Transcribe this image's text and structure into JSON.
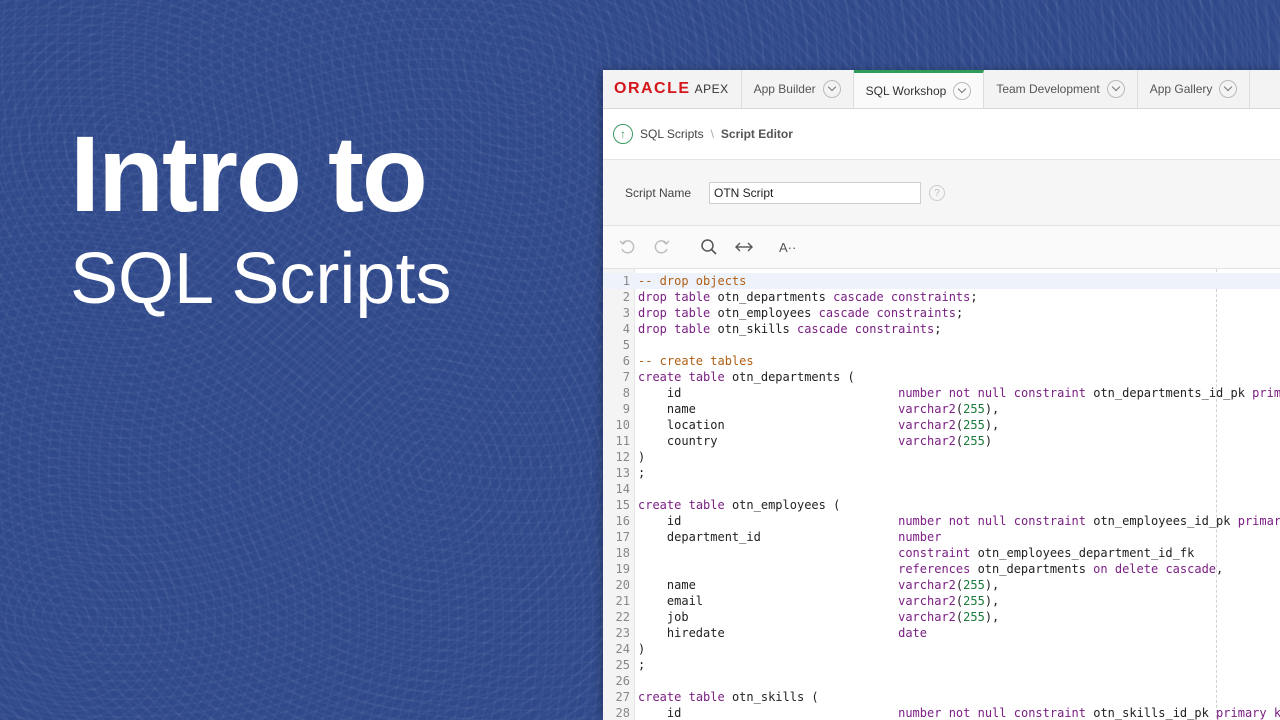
{
  "hero": {
    "line1": "Intro to",
    "line2": "SQL Scripts"
  },
  "nav": {
    "brand_oracle": "ORACLE",
    "brand_apex": "APEX",
    "tabs": [
      {
        "label": "App Builder",
        "active": false
      },
      {
        "label": "SQL Workshop",
        "active": true
      },
      {
        "label": "Team Development",
        "active": false
      },
      {
        "label": "App Gallery",
        "active": false
      }
    ]
  },
  "breadcrumb": {
    "parent": "SQL Scripts",
    "separator": "\\",
    "current": "Script Editor"
  },
  "form": {
    "script_name_label": "Script Name",
    "script_name_value": "OTN Script",
    "help_glyph": "?"
  },
  "toolbar": {
    "icons": [
      "undo-icon",
      "redo-icon",
      "search-icon",
      "expand-horizontal-icon",
      "text-size-icon"
    ],
    "font_button_label": "A··"
  },
  "editor": {
    "active_line": 1,
    "lines": [
      {
        "n": "1",
        "t": "-- drop objects"
      },
      {
        "n": "2",
        "t": "drop table otn_departments cascade constraints;"
      },
      {
        "n": "3",
        "t": "drop table otn_employees cascade constraints;"
      },
      {
        "n": "4",
        "t": "drop table otn_skills cascade constraints;"
      },
      {
        "n": "5",
        "t": ""
      },
      {
        "n": "6",
        "t": "-- create tables"
      },
      {
        "n": "7",
        "t": "create table otn_departments ("
      },
      {
        "n": "8",
        "t": "    id                              number not null constraint otn_departments_id_pk primary key,"
      },
      {
        "n": "9",
        "t": "    name                            varchar2(255),"
      },
      {
        "n": "10",
        "t": "    location                        varchar2(255),"
      },
      {
        "n": "11",
        "t": "    country                         varchar2(255)"
      },
      {
        "n": "12",
        "t": ")"
      },
      {
        "n": "13",
        "t": ";"
      },
      {
        "n": "14",
        "t": ""
      },
      {
        "n": "15",
        "t": "create table otn_employees ("
      },
      {
        "n": "16",
        "t": "    id                              number not null constraint otn_employees_id_pk primary key,"
      },
      {
        "n": "17",
        "t": "    department_id                   number"
      },
      {
        "n": "18",
        "t": "                                    constraint otn_employees_department_id_fk"
      },
      {
        "n": "19",
        "t": "                                    references otn_departments on delete cascade,"
      },
      {
        "n": "20",
        "t": "    name                            varchar2(255),"
      },
      {
        "n": "21",
        "t": "    email                           varchar2(255),"
      },
      {
        "n": "22",
        "t": "    job                             varchar2(255),"
      },
      {
        "n": "23",
        "t": "    hiredate                        date"
      },
      {
        "n": "24",
        "t": ")"
      },
      {
        "n": "25",
        "t": ";"
      },
      {
        "n": "26",
        "t": ""
      },
      {
        "n": "27",
        "t": "create table otn_skills ("
      },
      {
        "n": "28",
        "t": "    id                              number not null constraint otn_skills_id_pk primary key,"
      }
    ]
  },
  "colors": {
    "background": "#30498a",
    "oracle_red": "#d4161b",
    "active_tab_accent": "#2f9c5b",
    "keyword": "#7b1f84",
    "comment": "#b15e13",
    "number": "#1a7a3a"
  }
}
